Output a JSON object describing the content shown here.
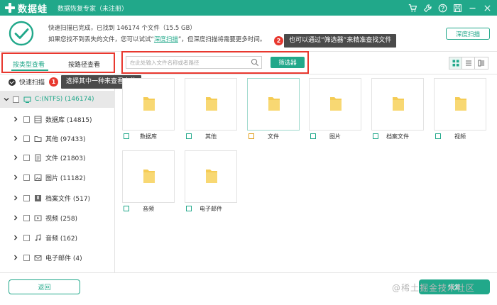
{
  "app": {
    "name": "数据蛙",
    "window_title": "数据恢复专家（未注册）"
  },
  "status": {
    "line1": "快速扫描已完成，已找到 146174 个文件（15.5 GB）",
    "line2_prefix": "如果您找不到丢失的文件，您可以试试“",
    "line2_link": "深度扫描",
    "line2_suffix": "”，但深度扫描将需要更多时间。",
    "deep_scan_button": "深度扫描"
  },
  "tabs": {
    "by_type": "按类型查看",
    "by_path": "按路径查看"
  },
  "search": {
    "placeholder": "在此处输入文件名称或者路径"
  },
  "filter_button": "筛选器",
  "tooltips": {
    "filter": {
      "badge": "2",
      "text": "也可以通过“筛选器”来精准查找文件"
    },
    "select": {
      "badge": "1",
      "text": "选择其中一种来查看文件"
    }
  },
  "sidebar": {
    "quick_scan": "快速扫描",
    "drive": "C:(NTFS) (146174)",
    "categories": [
      {
        "label": "数据库 (14815)",
        "icon": "database-icon"
      },
      {
        "label": "其他 (97433)",
        "icon": "folder-icon"
      },
      {
        "label": "文件 (21803)",
        "icon": "document-icon"
      },
      {
        "label": "图片 (11182)",
        "icon": "image-icon"
      },
      {
        "label": "档案文件 (517)",
        "icon": "archive-icon"
      },
      {
        "label": "视频 (258)",
        "icon": "video-icon"
      },
      {
        "label": "音频 (162)",
        "icon": "audio-icon"
      },
      {
        "label": "电子邮件 (4)",
        "icon": "email-icon"
      }
    ]
  },
  "grid": [
    {
      "label": "数据库"
    },
    {
      "label": "其他"
    },
    {
      "label": "文件"
    },
    {
      "label": "图片"
    },
    {
      "label": "档案文件"
    },
    {
      "label": "视频"
    },
    {
      "label": "音频"
    },
    {
      "label": "电子邮件"
    }
  ],
  "footer": {
    "back_button": "返回",
    "recover_button": "恢复",
    "watermark": "@稀土掘金技术社区"
  },
  "colors": {
    "accent": "#21a88a",
    "highlight": "#e8382f",
    "folder": "#f5cc55"
  }
}
